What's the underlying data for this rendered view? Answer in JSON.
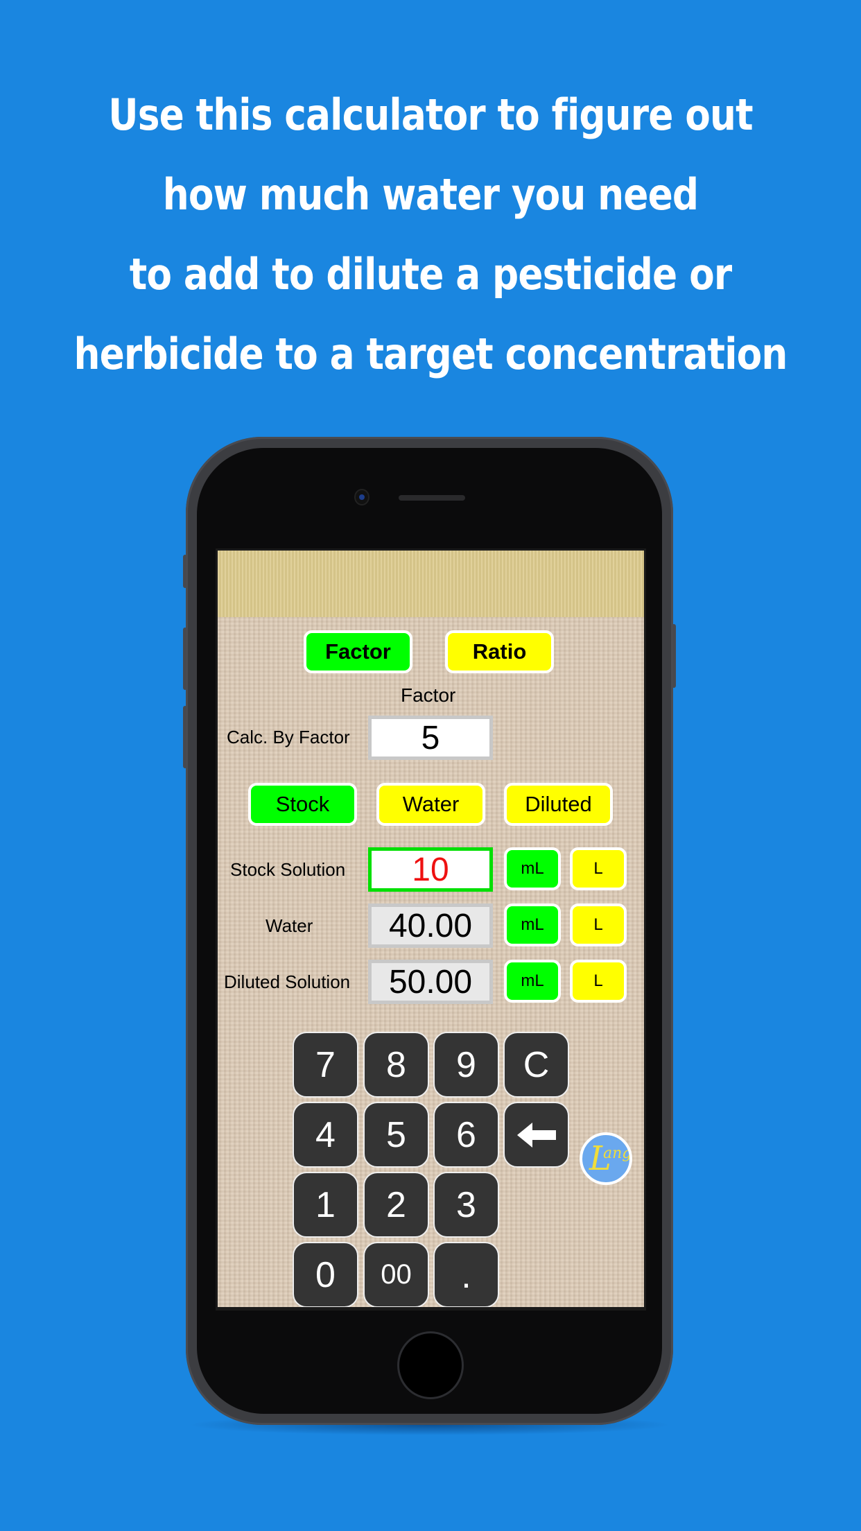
{
  "promo": {
    "headline_lines": [
      "Use this calculator to figure out",
      "how much water you need",
      "to add to dilute a pesticide or",
      "herbicide to a target concentration"
    ]
  },
  "app": {
    "mode_buttons": [
      {
        "label": "Factor",
        "active": true
      },
      {
        "label": "Ratio",
        "active": false
      }
    ],
    "factor": {
      "heading": "Factor",
      "row_label": "Calc. By Factor",
      "value": "5"
    },
    "solve_for_buttons": [
      {
        "label": "Stock",
        "active": true
      },
      {
        "label": "Water",
        "active": false
      },
      {
        "label": "Diluted",
        "active": false
      }
    ],
    "rows": [
      {
        "label": "Stock Solution",
        "value": "10",
        "editable": true,
        "unit_ml": "mL",
        "unit_l": "L",
        "selected_unit": "mL"
      },
      {
        "label": "Water",
        "value": "40.00",
        "editable": false,
        "unit_ml": "mL",
        "unit_l": "L",
        "selected_unit": "mL"
      },
      {
        "label": "Diluted Solution",
        "value": "50.00",
        "editable": false,
        "unit_ml": "mL",
        "unit_l": "L",
        "selected_unit": "mL"
      }
    ],
    "keypad": {
      "row1": [
        "7",
        "8",
        "9",
        "C"
      ],
      "row2": [
        "4",
        "5",
        "6",
        "backspace-icon"
      ],
      "row3": [
        "1",
        "2",
        "3"
      ],
      "row4": [
        "0",
        "00",
        "."
      ]
    },
    "logo": {
      "big": "L",
      "small": "ang"
    }
  },
  "colors": {
    "background": "#1a86e0",
    "active": "#00ff00",
    "inactive": "#ffff00",
    "input_value": "#ee1111",
    "key": "#343434"
  }
}
